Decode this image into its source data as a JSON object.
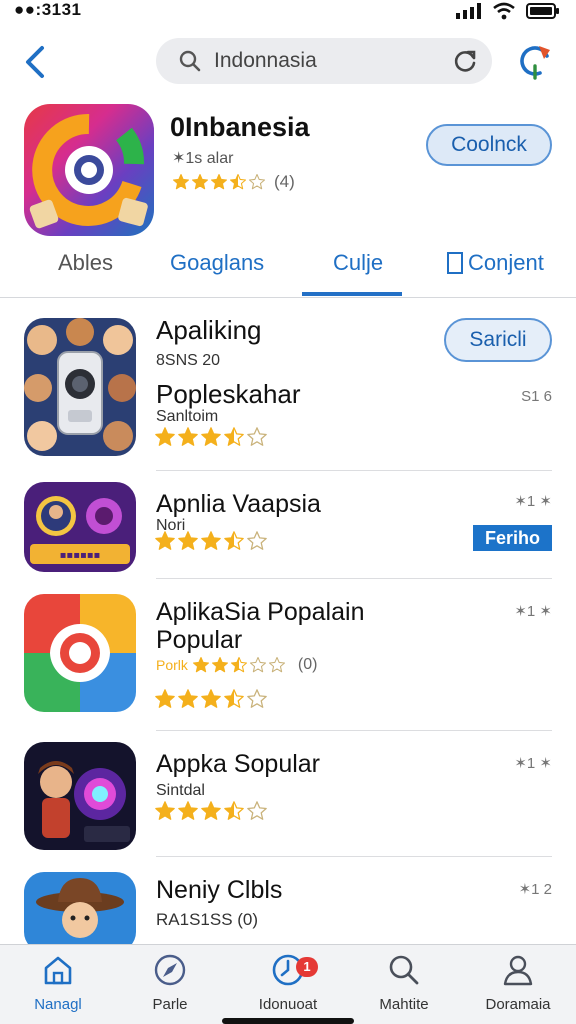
{
  "status_bar": {
    "time": "●●:3131"
  },
  "search": {
    "query": "Indonnasia"
  },
  "app": {
    "title": "0Inbanesia",
    "subtitle": "✶1s alar",
    "rating_count": "(4)",
    "rating": 3.5,
    "get_label": "Coolnck"
  },
  "tabs": [
    {
      "label": "Ables"
    },
    {
      "label": "Goaglans"
    },
    {
      "label": "Culje"
    },
    {
      "label": "Conjent"
    }
  ],
  "list": [
    {
      "title": "Apaliking",
      "line1": "8SNS 20",
      "title2": "Popleskahar",
      "line2": "Sanltoim",
      "rank": "S1 6",
      "rating": 3.5,
      "button_label": "Saricli"
    },
    {
      "title": "Apnlia Vaapsia",
      "line1": "Nori",
      "rank": "✶1 ✶",
      "rating": 3.5,
      "button_label": "Feriho"
    },
    {
      "title": "AplikaSia Popalain",
      "title2": "Popular",
      "line1": "Porlk",
      "line1_count": "(0)",
      "rank": "✶1 ✶",
      "rating": 2.5,
      "rating2": 3.5
    },
    {
      "title": "Appka Sopular",
      "line1": "Sintdal",
      "rank": "✶1 ✶",
      "rating": 3.5
    },
    {
      "title": "Neniy Clbls",
      "line1": "RA1S1SS (0)",
      "rank": "✶1 2"
    }
  ],
  "tabbar": [
    {
      "label": "Nanagl",
      "active": true
    },
    {
      "label": "Parle"
    },
    {
      "label": "Idonuoat",
      "badge": "1"
    },
    {
      "label": "Mahtite"
    },
    {
      "label": "Doramaia"
    }
  ],
  "colors": {
    "accent": "#1f6fc4",
    "star": "#f4b01c",
    "badge": "#e53935"
  }
}
